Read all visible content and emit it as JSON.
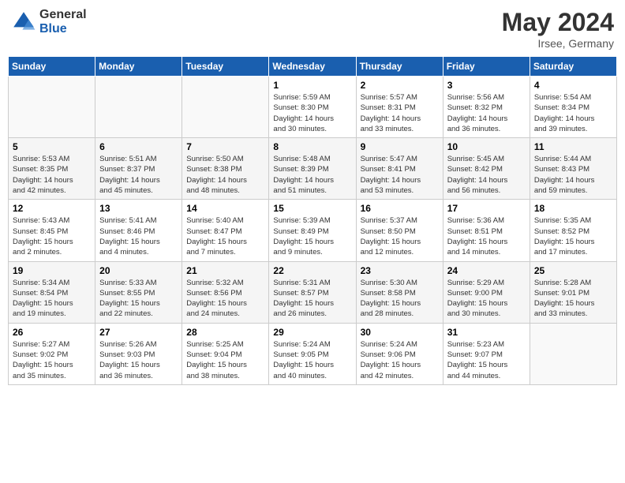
{
  "header": {
    "logo_general": "General",
    "logo_blue": "Blue",
    "month_year": "May 2024",
    "location": "Irsee, Germany"
  },
  "weekdays": [
    "Sunday",
    "Monday",
    "Tuesday",
    "Wednesday",
    "Thursday",
    "Friday",
    "Saturday"
  ],
  "weeks": [
    [
      {
        "day": "",
        "info": ""
      },
      {
        "day": "",
        "info": ""
      },
      {
        "day": "",
        "info": ""
      },
      {
        "day": "1",
        "info": "Sunrise: 5:59 AM\nSunset: 8:30 PM\nDaylight: 14 hours\nand 30 minutes."
      },
      {
        "day": "2",
        "info": "Sunrise: 5:57 AM\nSunset: 8:31 PM\nDaylight: 14 hours\nand 33 minutes."
      },
      {
        "day": "3",
        "info": "Sunrise: 5:56 AM\nSunset: 8:32 PM\nDaylight: 14 hours\nand 36 minutes."
      },
      {
        "day": "4",
        "info": "Sunrise: 5:54 AM\nSunset: 8:34 PM\nDaylight: 14 hours\nand 39 minutes."
      }
    ],
    [
      {
        "day": "5",
        "info": "Sunrise: 5:53 AM\nSunset: 8:35 PM\nDaylight: 14 hours\nand 42 minutes."
      },
      {
        "day": "6",
        "info": "Sunrise: 5:51 AM\nSunset: 8:37 PM\nDaylight: 14 hours\nand 45 minutes."
      },
      {
        "day": "7",
        "info": "Sunrise: 5:50 AM\nSunset: 8:38 PM\nDaylight: 14 hours\nand 48 minutes."
      },
      {
        "day": "8",
        "info": "Sunrise: 5:48 AM\nSunset: 8:39 PM\nDaylight: 14 hours\nand 51 minutes."
      },
      {
        "day": "9",
        "info": "Sunrise: 5:47 AM\nSunset: 8:41 PM\nDaylight: 14 hours\nand 53 minutes."
      },
      {
        "day": "10",
        "info": "Sunrise: 5:45 AM\nSunset: 8:42 PM\nDaylight: 14 hours\nand 56 minutes."
      },
      {
        "day": "11",
        "info": "Sunrise: 5:44 AM\nSunset: 8:43 PM\nDaylight: 14 hours\nand 59 minutes."
      }
    ],
    [
      {
        "day": "12",
        "info": "Sunrise: 5:43 AM\nSunset: 8:45 PM\nDaylight: 15 hours\nand 2 minutes."
      },
      {
        "day": "13",
        "info": "Sunrise: 5:41 AM\nSunset: 8:46 PM\nDaylight: 15 hours\nand 4 minutes."
      },
      {
        "day": "14",
        "info": "Sunrise: 5:40 AM\nSunset: 8:47 PM\nDaylight: 15 hours\nand 7 minutes."
      },
      {
        "day": "15",
        "info": "Sunrise: 5:39 AM\nSunset: 8:49 PM\nDaylight: 15 hours\nand 9 minutes."
      },
      {
        "day": "16",
        "info": "Sunrise: 5:37 AM\nSunset: 8:50 PM\nDaylight: 15 hours\nand 12 minutes."
      },
      {
        "day": "17",
        "info": "Sunrise: 5:36 AM\nSunset: 8:51 PM\nDaylight: 15 hours\nand 14 minutes."
      },
      {
        "day": "18",
        "info": "Sunrise: 5:35 AM\nSunset: 8:52 PM\nDaylight: 15 hours\nand 17 minutes."
      }
    ],
    [
      {
        "day": "19",
        "info": "Sunrise: 5:34 AM\nSunset: 8:54 PM\nDaylight: 15 hours\nand 19 minutes."
      },
      {
        "day": "20",
        "info": "Sunrise: 5:33 AM\nSunset: 8:55 PM\nDaylight: 15 hours\nand 22 minutes."
      },
      {
        "day": "21",
        "info": "Sunrise: 5:32 AM\nSunset: 8:56 PM\nDaylight: 15 hours\nand 24 minutes."
      },
      {
        "day": "22",
        "info": "Sunrise: 5:31 AM\nSunset: 8:57 PM\nDaylight: 15 hours\nand 26 minutes."
      },
      {
        "day": "23",
        "info": "Sunrise: 5:30 AM\nSunset: 8:58 PM\nDaylight: 15 hours\nand 28 minutes."
      },
      {
        "day": "24",
        "info": "Sunrise: 5:29 AM\nSunset: 9:00 PM\nDaylight: 15 hours\nand 30 minutes."
      },
      {
        "day": "25",
        "info": "Sunrise: 5:28 AM\nSunset: 9:01 PM\nDaylight: 15 hours\nand 33 minutes."
      }
    ],
    [
      {
        "day": "26",
        "info": "Sunrise: 5:27 AM\nSunset: 9:02 PM\nDaylight: 15 hours\nand 35 minutes."
      },
      {
        "day": "27",
        "info": "Sunrise: 5:26 AM\nSunset: 9:03 PM\nDaylight: 15 hours\nand 36 minutes."
      },
      {
        "day": "28",
        "info": "Sunrise: 5:25 AM\nSunset: 9:04 PM\nDaylight: 15 hours\nand 38 minutes."
      },
      {
        "day": "29",
        "info": "Sunrise: 5:24 AM\nSunset: 9:05 PM\nDaylight: 15 hours\nand 40 minutes."
      },
      {
        "day": "30",
        "info": "Sunrise: 5:24 AM\nSunset: 9:06 PM\nDaylight: 15 hours\nand 42 minutes."
      },
      {
        "day": "31",
        "info": "Sunrise: 5:23 AM\nSunset: 9:07 PM\nDaylight: 15 hours\nand 44 minutes."
      },
      {
        "day": "",
        "info": ""
      }
    ]
  ]
}
